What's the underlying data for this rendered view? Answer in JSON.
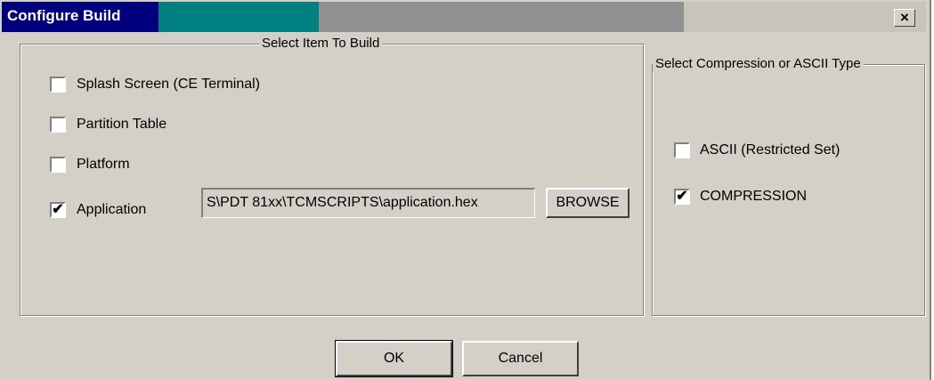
{
  "window": {
    "title": "Configure Build",
    "close_glyph": "×"
  },
  "build_group": {
    "legend": "Select Item To Build",
    "items": [
      {
        "label": "Splash Screen (CE Terminal)",
        "checked": false
      },
      {
        "label": "Partition Table",
        "checked": false
      },
      {
        "label": "Platform",
        "checked": false
      },
      {
        "label": "Application",
        "checked": true
      }
    ],
    "path_value": "S\\PDT 81xx\\TCMSCRIPTS\\application.hex",
    "browse_label": "BROWSE"
  },
  "type_group": {
    "legend": "Select Compression or ASCII Type",
    "items": [
      {
        "label": "ASCII (Restricted Set)",
        "checked": false
      },
      {
        "label": "COMPRESSION",
        "checked": true
      }
    ]
  },
  "buttons": {
    "ok_label": "OK",
    "cancel_label": "Cancel"
  },
  "check_glyph": "✔"
}
